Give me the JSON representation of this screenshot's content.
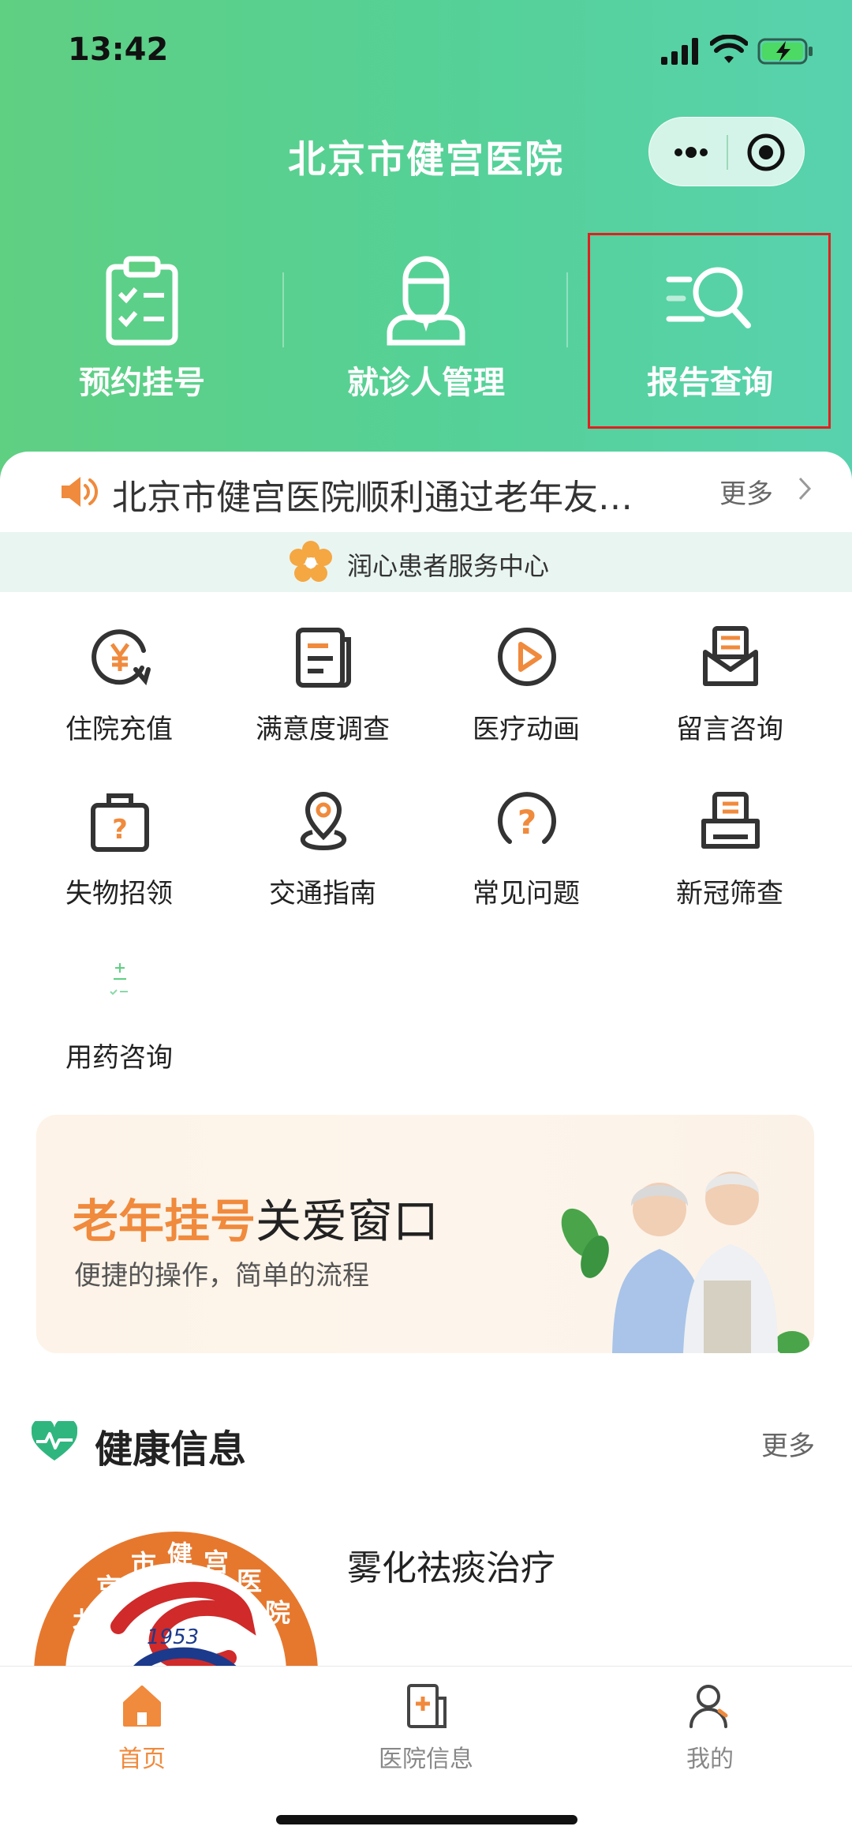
{
  "status_bar": {
    "time": "13:42"
  },
  "header": {
    "title": "北京市健宫医院"
  },
  "quick_entries": [
    {
      "label": "预约挂号",
      "icon": "clipboard-check-icon"
    },
    {
      "label": "就诊人管理",
      "icon": "doctor-icon"
    },
    {
      "label": "报告查询",
      "icon": "search-report-icon",
      "highlighted": true
    }
  ],
  "notice": {
    "text": "北京市健宫医院顺利通过老年友…",
    "more_label": "更多"
  },
  "service_center": {
    "label": "润心患者服务中心"
  },
  "services": [
    {
      "label": "住院充值",
      "icon": "yen-refresh-icon"
    },
    {
      "label": "满意度调查",
      "icon": "survey-icon"
    },
    {
      "label": "医疗动画",
      "icon": "play-icon"
    },
    {
      "label": "留言咨询",
      "icon": "mail-icon"
    },
    {
      "label": "失物招领",
      "icon": "lost-found-icon"
    },
    {
      "label": "交通指南",
      "icon": "location-pin-icon"
    },
    {
      "label": "常见问题",
      "icon": "question-icon"
    },
    {
      "label": "新冠筛查",
      "icon": "covid-screening-icon"
    },
    {
      "label": "用药咨询",
      "icon": "medicine-icon"
    }
  ],
  "banner": {
    "title_highlight": "老年挂号",
    "title_rest": "关爱窗口",
    "subtitle": "便捷的操作，简单的流程"
  },
  "health_section": {
    "title": "健康信息",
    "more_label": "更多"
  },
  "article": {
    "title": "雾化祛痰治疗",
    "logo_year": "1953"
  },
  "tab_bar": [
    {
      "label": "首页",
      "icon": "home-icon",
      "active": true
    },
    {
      "label": "医院信息",
      "icon": "hospital-info-icon",
      "active": false
    },
    {
      "label": "我的",
      "icon": "user-icon",
      "active": false
    }
  ],
  "colors": {
    "header_green": "#5fcf82",
    "accent_orange": "#f08a3c",
    "highlight_red": "#e02020"
  }
}
